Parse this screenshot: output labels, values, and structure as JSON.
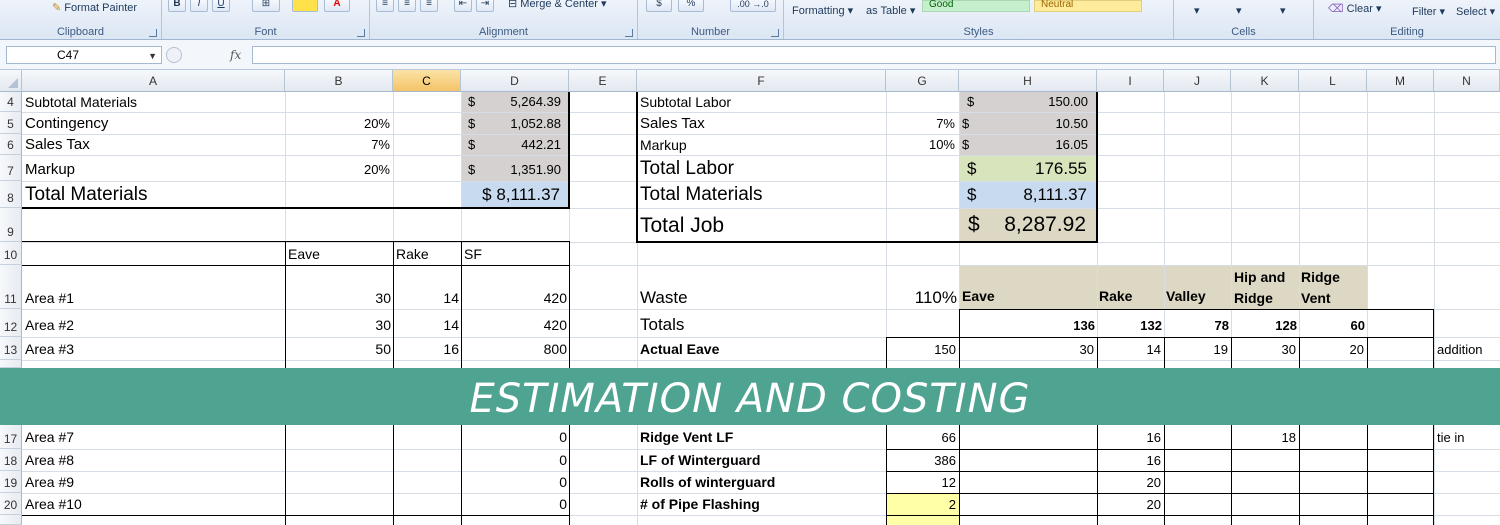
{
  "ribbon": {
    "format_painter": "Format Painter",
    "groups": {
      "clipboard": "Clipboard",
      "font": "Font",
      "alignment": "Alignment",
      "number": "Number",
      "styles": "Styles",
      "cells": "Cells",
      "editing": "Editing"
    },
    "merge_center": "Merge & Center",
    "conditional_formatting": "Formatting",
    "format_as_table": "as Table",
    "style_good": "Good",
    "style_neutral": "Neutral",
    "clear": "Clear",
    "filter": "Filter",
    "select": "Select",
    "number_buttons": [
      "$",
      "%",
      ".00 →.0"
    ],
    "font_buttons": [
      "B",
      "I",
      "U"
    ]
  },
  "formula_bar": {
    "name_box": "C47",
    "fx": "fx",
    "formula": ""
  },
  "columns": [
    "A",
    "B",
    "C",
    "D",
    "E",
    "F",
    "G",
    "H",
    "I",
    "J",
    "K",
    "L",
    "M",
    "N"
  ],
  "selected_column": "C",
  "rows": [
    "4",
    "5",
    "6",
    "7",
    "8",
    "9",
    "10",
    "11",
    "12",
    "13",
    "17",
    "18",
    "19",
    "20",
    "21"
  ],
  "sheet": {
    "a4": "Subtotal Materials",
    "d4_sym": "$",
    "d4": "5,264.39",
    "a5": "Contingency",
    "b5": "20%",
    "d5_sym": "$",
    "d5": "1,052.88",
    "a6": "Sales Tax",
    "b6": "7%",
    "d6_sym": "$",
    "d6": "442.21",
    "a7": "Markup",
    "b7": "20%",
    "d7_sym": "$",
    "d7": "1,351.90",
    "a8": "Total Materials",
    "d8": "$ 8,111.37",
    "f4": "Subtotal Labor",
    "h4_sym": "$",
    "h4": "150.00",
    "f5": "Sales Tax",
    "g5": "7%",
    "h5_sym": "$",
    "h5": "10.50",
    "f6": "Markup",
    "g6": "10%",
    "h6_sym": "$",
    "h6": "16.05",
    "f7": "Total Labor",
    "h7_sym": "$",
    "h7": "176.55",
    "f8": "Total Materials",
    "h8_sym": "$",
    "h8": "8,111.37",
    "f9": "Total Job",
    "h9_sym": "$",
    "h9": "8,287.92",
    "b10": "Eave",
    "c10": "Rake",
    "d10": "SF",
    "a11": "Area #1",
    "b11": "30",
    "c11": "14",
    "d11": "420",
    "a12": "Area #2",
    "b12": "30",
    "c12": "14",
    "d12": "420",
    "a13": "Area #3",
    "b13": "50",
    "c13": "16",
    "d13": "800",
    "f11": "Waste",
    "g11": "110%",
    "h11": "Eave",
    "i11": "Rake",
    "j11": "Valley",
    "k11": "Hip and Ridge",
    "l11": "Ridge Vent",
    "f12": "Totals",
    "h12": "136",
    "i12": "132",
    "j12": "78",
    "k12": "128",
    "l12": "60",
    "f13": "Actual Eave",
    "g13": "150",
    "h13": "30",
    "i13": "14",
    "j13": "19",
    "k13": "30",
    "l13": "20",
    "n13": "addition",
    "a17": "Area #7",
    "d17": "0",
    "f17": "Ridge Vent LF",
    "g17": "66",
    "i17": "16",
    "k17": "18",
    "n17": "tie in",
    "a18": "Area #8",
    "d18": "0",
    "f18": "LF of Winterguard",
    "g18": "386",
    "i18": "16",
    "a19": "Area #9",
    "d19": "0",
    "f19": "Rolls of winterguard",
    "g19": "12",
    "i19": "20",
    "a20": "Area #10",
    "d20": "0",
    "f20": "# of Pipe Flashing",
    "g20": "2",
    "i20": "20"
  },
  "banner": {
    "text": "ESTIMATION AND COSTING",
    "color": "#4fa391"
  }
}
